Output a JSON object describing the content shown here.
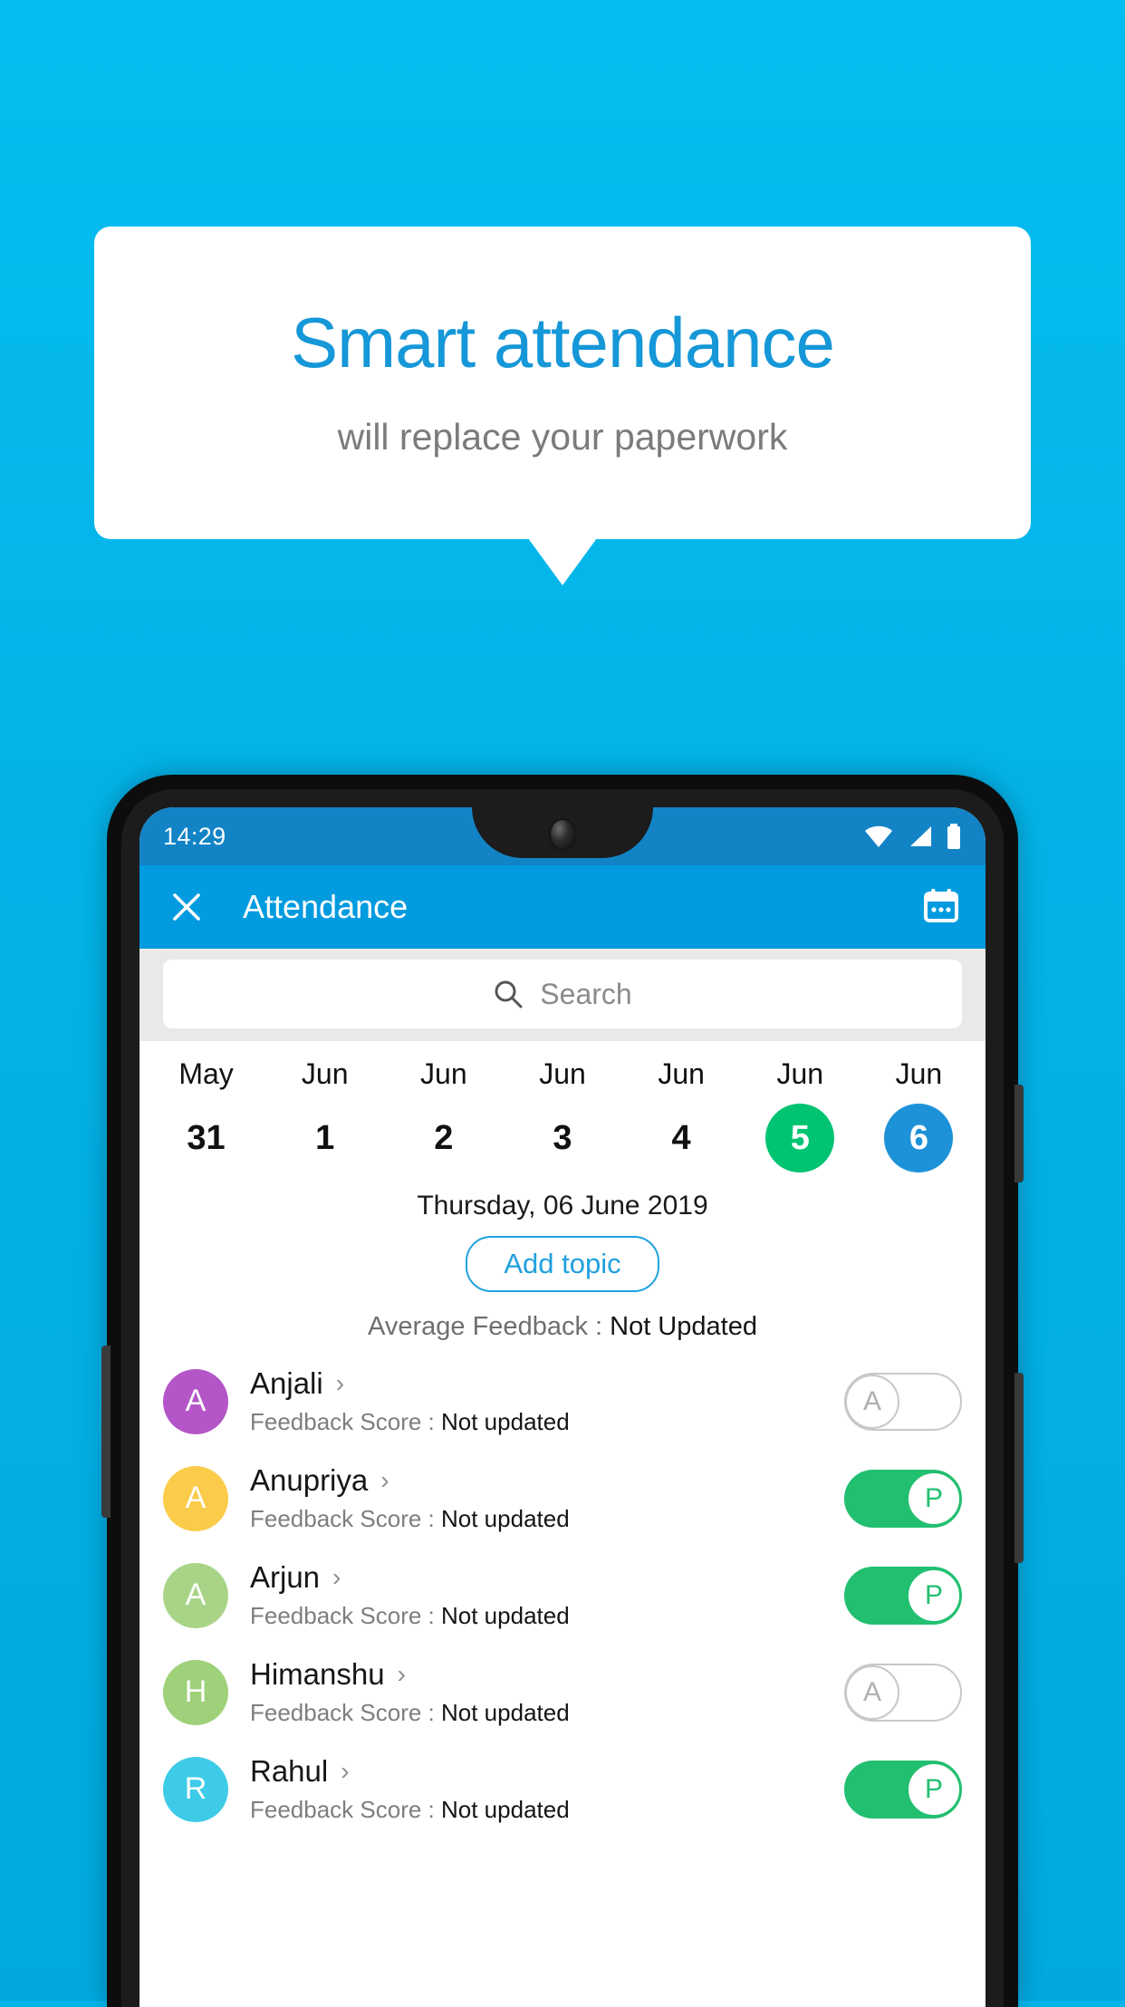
{
  "promo": {
    "headline": "Smart attendance",
    "subhead": "will replace your paperwork",
    "headline_color": "#1597d8",
    "background_color": "#03b3e8"
  },
  "phone": {
    "statusbar": {
      "time": "14:29",
      "icons": [
        "wifi-icon",
        "signal-icon",
        "battery-icon"
      ]
    },
    "appbar": {
      "close_icon": "close-icon",
      "title": "Attendance",
      "action_icon": "calendar-icon",
      "background_color": "#029bdf"
    },
    "search": {
      "icon": "search-icon",
      "placeholder": "Search",
      "value": ""
    },
    "dates": [
      {
        "month": "May",
        "day": "31",
        "state": "normal"
      },
      {
        "month": "Jun",
        "day": "1",
        "state": "normal"
      },
      {
        "month": "Jun",
        "day": "2",
        "state": "normal"
      },
      {
        "month": "Jun",
        "day": "3",
        "state": "normal"
      },
      {
        "month": "Jun",
        "day": "4",
        "state": "normal"
      },
      {
        "month": "Jun",
        "day": "5",
        "state": "green"
      },
      {
        "month": "Jun",
        "day": "6",
        "state": "blue"
      }
    ],
    "selected_date_label": "Thursday, 06 June 2019",
    "add_topic_label": "Add topic",
    "average_feedback": {
      "label": "Average Feedback : ",
      "value": "Not Updated"
    },
    "feedback_label": "Feedback Score : ",
    "students": [
      {
        "name": "Anjali",
        "initial": "A",
        "avatar_color": "#b456c8",
        "feedback_value": "Not updated",
        "attendance": "A",
        "present": false
      },
      {
        "name": "Anupriya",
        "initial": "A",
        "avatar_color": "#fbcb4a",
        "feedback_value": "Not updated",
        "attendance": "P",
        "present": true
      },
      {
        "name": "Arjun",
        "initial": "A",
        "avatar_color": "#a9d488",
        "feedback_value": "Not updated",
        "attendance": "P",
        "present": true
      },
      {
        "name": "Himanshu",
        "initial": "H",
        "avatar_color": "#9ed17a",
        "feedback_value": "Not updated",
        "attendance": "A",
        "present": false
      },
      {
        "name": "Rahul",
        "initial": "R",
        "avatar_color": "#3ecbe8",
        "feedback_value": "Not updated",
        "attendance": "P",
        "present": true
      }
    ]
  }
}
